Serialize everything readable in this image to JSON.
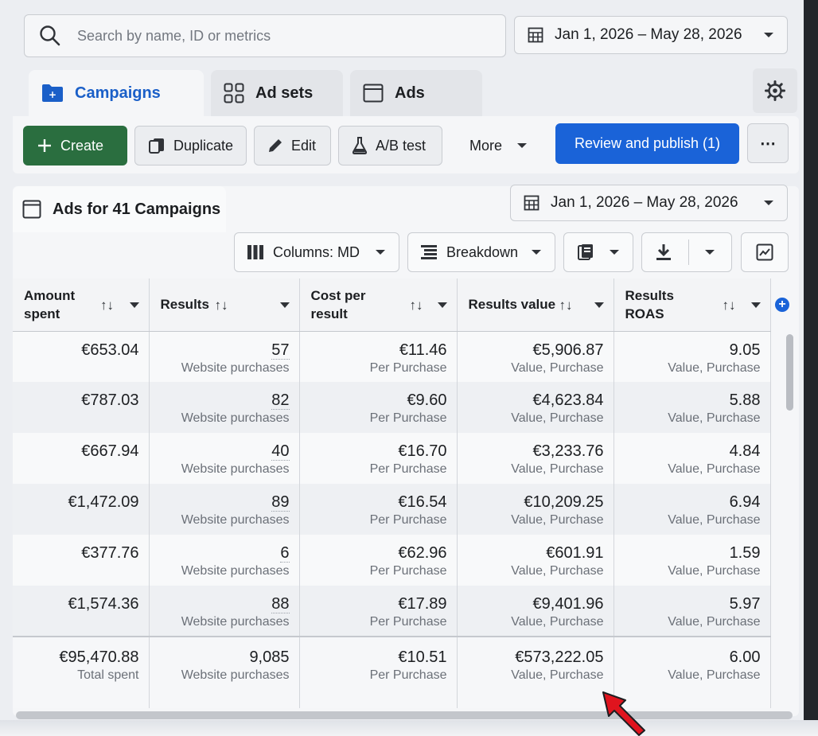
{
  "search": {
    "placeholder": "Search by name, ID or metrics"
  },
  "date_range": "Jan 1, 2026 – May 28, 2026",
  "tabs": [
    {
      "label": "Campaigns",
      "icon": "folder-icon",
      "active": true
    },
    {
      "label": "Ad sets",
      "icon": "grid-icon"
    },
    {
      "label": "Ads",
      "icon": "ad-page-icon"
    }
  ],
  "toolbar": {
    "create": "Create",
    "duplicate": "Duplicate",
    "edit": "Edit",
    "ab_test": "A/B test",
    "more": "More",
    "publish": "Review and publish (1)",
    "overflow": "⋯"
  },
  "panel": {
    "title": "Ads for 41 Campaigns",
    "date_range": "Jan 1, 2026 – May 28, 2026",
    "columns_label": "Columns: MD",
    "breakdown_label": "Breakdown"
  },
  "table": {
    "headers": {
      "amount": "Amount spent",
      "results": "Results",
      "cost": "Cost per result",
      "value": "Results value",
      "roas": "Results ROAS"
    },
    "rows": [
      {
        "amount": "€653.04",
        "results": "57",
        "results_sub": "Website purchases",
        "cost": "€11.46",
        "cost_sub": "Per Purchase",
        "value": "€5,906.87",
        "value_sub": "Value, Purchase",
        "roas": "9.05",
        "roas_sub": "Value, Purchase"
      },
      {
        "amount": "€787.03",
        "results": "82",
        "results_sub": "Website purchases",
        "cost": "€9.60",
        "cost_sub": "Per Purchase",
        "value": "€4,623.84",
        "value_sub": "Value, Purchase",
        "roas": "5.88",
        "roas_sub": "Value, Purchase"
      },
      {
        "amount": "€667.94",
        "results": "40",
        "results_sub": "Website purchases",
        "cost": "€16.70",
        "cost_sub": "Per Purchase",
        "value": "€3,233.76",
        "value_sub": "Value, Purchase",
        "roas": "4.84",
        "roas_sub": "Value, Purchase"
      },
      {
        "amount": "€1,472.09",
        "results": "89",
        "results_sub": "Website purchases",
        "cost": "€16.54",
        "cost_sub": "Per Purchase",
        "value": "€10,209.25",
        "value_sub": "Value, Purchase",
        "roas": "6.94",
        "roas_sub": "Value, Purchase"
      },
      {
        "amount": "€377.76",
        "results": "6",
        "results_sub": "Website purchases",
        "cost": "€62.96",
        "cost_sub": "Per Purchase",
        "value": "€601.91",
        "value_sub": "Value, Purchase",
        "roas": "1.59",
        "roas_sub": "Value, Purchase"
      },
      {
        "amount": "€1,574.36",
        "results": "88",
        "results_sub": "Website purchases",
        "cost": "€17.89",
        "cost_sub": "Per Purchase",
        "value": "€9,401.96",
        "value_sub": "Value, Purchase",
        "roas": "5.97",
        "roas_sub": "Value, Purchase"
      }
    ],
    "total": {
      "amount": "€95,470.88",
      "amount_sub": "Total spent",
      "results": "9,085",
      "results_sub": "Website purchases",
      "cost": "€10.51",
      "cost_sub": "Per Purchase",
      "value": "€573,222.05",
      "value_sub": "Value, Purchase",
      "roas": "6.00",
      "roas_sub": "Value, Purchase"
    }
  },
  "colors": {
    "accent": "#1a63d8",
    "create": "#2a6e3f",
    "annotation_arrow": "#e0141e"
  }
}
